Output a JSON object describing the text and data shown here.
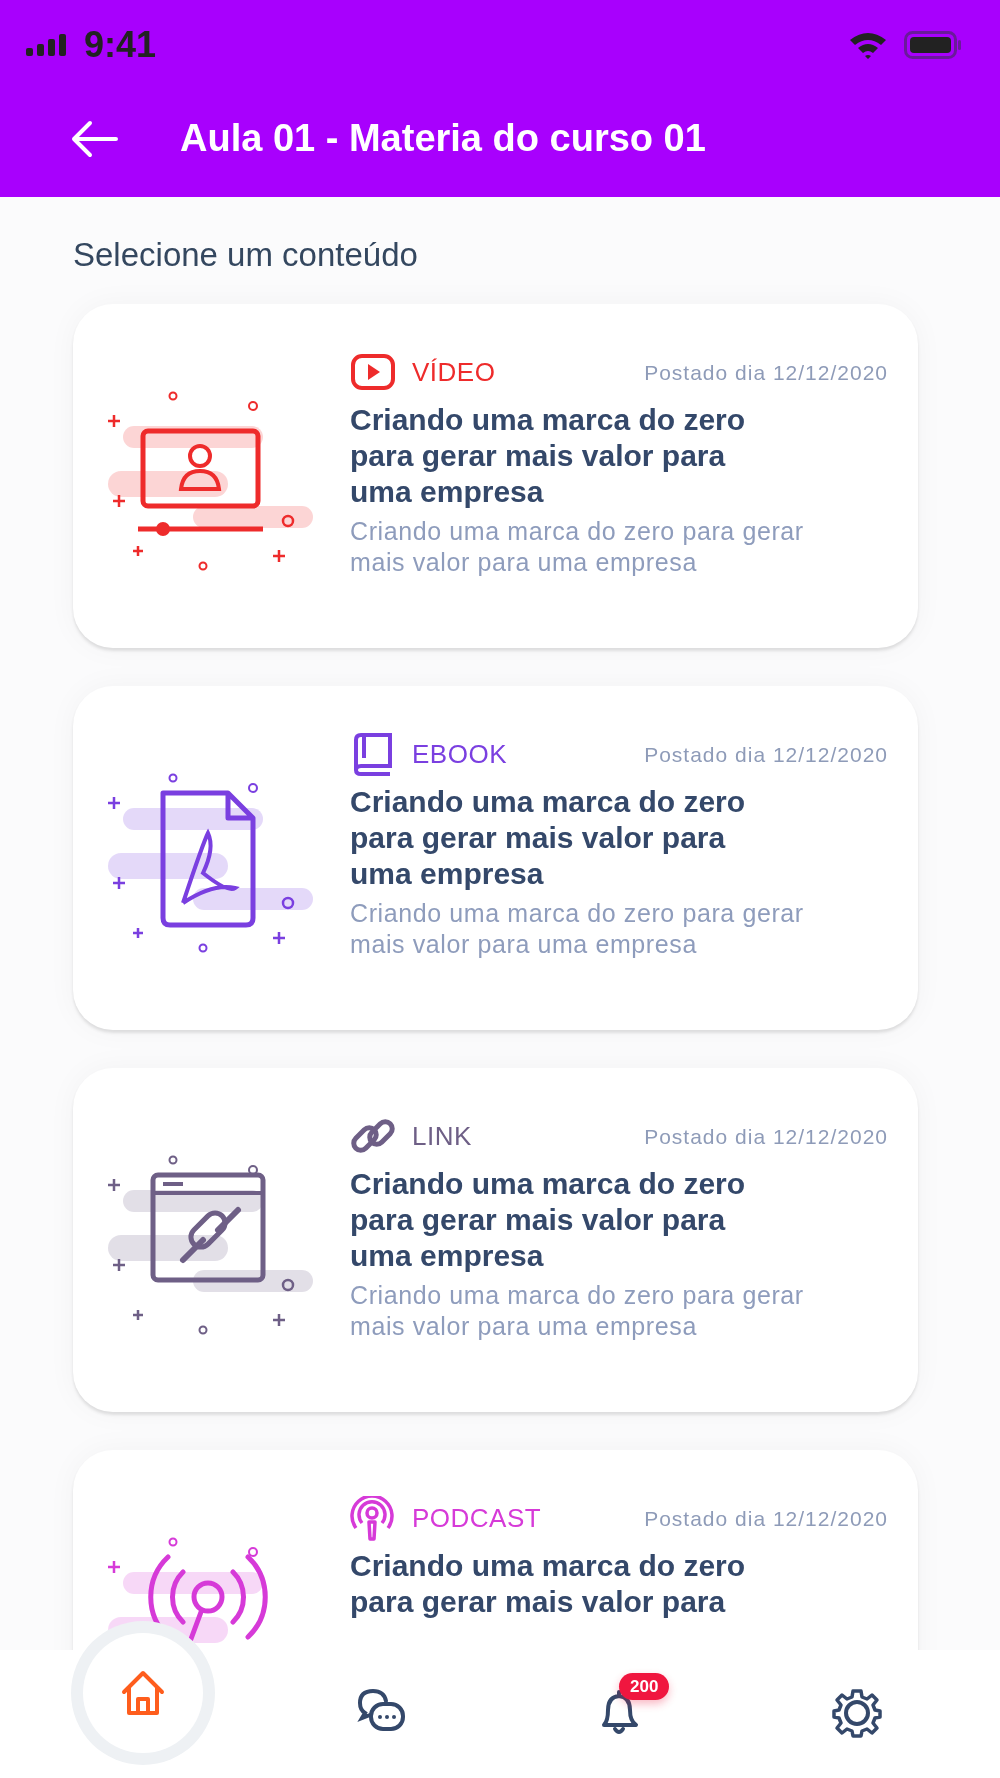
{
  "status_bar": {
    "time": "9:41"
  },
  "header": {
    "title": "Aula 01 - Materia do curso 01"
  },
  "section_title": "Selecione um conteúdo",
  "items": [
    {
      "kind": "video",
      "type_label": "VÍDEO",
      "color": "#ee2b2b",
      "date": "Postado dia 12/12/2020",
      "title": "Criando uma marca do zero para gerar mais valor para uma empresa",
      "description": "Criando uma marca do zero para gerar mais valor para uma empresa"
    },
    {
      "kind": "ebook",
      "type_label": "EBOOK",
      "color": "#7a3fe0",
      "date": "Postado dia 12/12/2020",
      "title": "Criando uma marca do zero para gerar mais valor para uma empresa",
      "description": "Criando uma marca do zero para gerar mais valor para uma empresa"
    },
    {
      "kind": "link",
      "type_label": "LINK",
      "color": "#6e5f86",
      "date": "Postado dia 12/12/2020",
      "title": "Criando uma marca do zero para gerar mais valor para uma empresa",
      "description": "Criando uma marca do zero para gerar mais valor para uma empresa"
    },
    {
      "kind": "podcast",
      "type_label": "PODCAST",
      "color": "#d63ad8",
      "date": "Postado dia 12/12/2020",
      "title": "Criando uma marca do zero para gerar mais valor para"
    }
  ],
  "bottom_nav": [
    {
      "kind": "home",
      "selected": true
    },
    {
      "kind": "chat",
      "selected": false
    },
    {
      "kind": "notifications",
      "selected": false,
      "badge": "200"
    },
    {
      "kind": "settings",
      "selected": false
    }
  ]
}
